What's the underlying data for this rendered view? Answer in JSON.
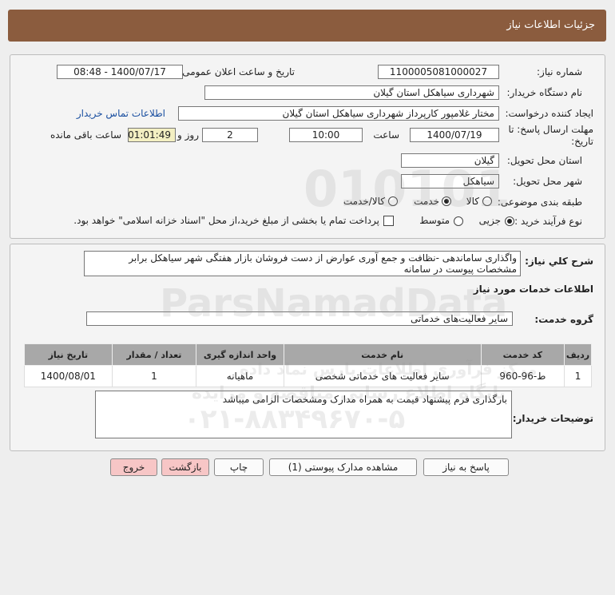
{
  "header": {
    "title": "جزئیات اطلاعات نیاز"
  },
  "form": {
    "need_number_label": "شماره نیاز:",
    "need_number": "1100005081000027",
    "announce_label": "تاریخ و ساعت اعلان عمومی:",
    "announce_value": "1400/07/17 - 08:48",
    "buyer_org_label": "نام دستگاه خریدار:",
    "buyer_org": "شهرداری سیاهکل استان گیلان",
    "creator_label": "ایجاد کننده درخواست:",
    "creator": "مختار غلامپور کارپرداز شهرداری سیاهکل استان گیلان",
    "contact_link": "اطلاعات تماس خریدار",
    "deadline_label_1": "مهلت ارسال پاسخ: تا",
    "deadline_label_2": "تاریخ:",
    "deadline_date": "1400/07/19",
    "time_label": "ساعت",
    "deadline_time": "10:00",
    "days_value": "2",
    "days_label": "روز و",
    "remaining_time": "01:01:49",
    "remaining_label": "ساعت باقی مانده",
    "province_label": "استان محل تحویل:",
    "province": "گیلان",
    "city_label": "شهر محل تحویل:",
    "city": "سیاهکل",
    "category_label": "طبقه بندی موضوعی:",
    "category_options": [
      "کالا",
      "خدمت",
      "کالا/خدمت"
    ],
    "process_label": "نوع فرآیند خرید :",
    "process_options": [
      "جزیی",
      "متوسط"
    ],
    "payment_note": "پرداخت تمام یا بخشی از مبلغ خرید،از محل \"اسناد خزانه اسلامی\" خواهد بود."
  },
  "description": {
    "label": "شرح کلي نياز:",
    "text": "واگذاری ساماندهی -نظافت و جمع آوری عوارض  از دست فروشان بازار هفتگی  شهر سیاهکل برابر مشخصات پیوست در سامانه",
    "services_title": "اطلاعات خدمات مورد نیاز",
    "group_label": "گروه خدمت:",
    "group_value": "سایر فعالیت‌های خدماتی"
  },
  "table": {
    "headers": [
      "ردیف",
      "کد خدمت",
      "نام خدمت",
      "واحد اندازه گیری",
      "تعداد / مقدار",
      "تاریخ نیاز"
    ],
    "rows": [
      [
        "1",
        "ط-96-960",
        "سایر فعالیت های خدماتی شخصی",
        "ماهیانه",
        "1",
        "1400/08/01"
      ]
    ]
  },
  "buyer_notes": {
    "label": "توضیحات خریدار:",
    "text": "بارگذاری فرم پیشنهاد قیمت به همراه مدارک ومشخصات الزامی میباشد"
  },
  "buttons": {
    "reply": "پاسخ به نیاز",
    "attachments": "مشاهده مدارک پیوستی (1)",
    "print": "چاپ",
    "back": "بازگشت",
    "exit": "خروج"
  },
  "watermark": {
    "digits": "010101",
    "brand": "ParsNamadData",
    "fa_line1": "مرکز فرآوری اطلاعات پارس نماد داده",
    "fa_line2": "پایگاه اطلاع رسانی مناقصه و مزایده",
    "phone": "۰۲۱-۸۸۳۴۹۶۷۰-۵"
  }
}
